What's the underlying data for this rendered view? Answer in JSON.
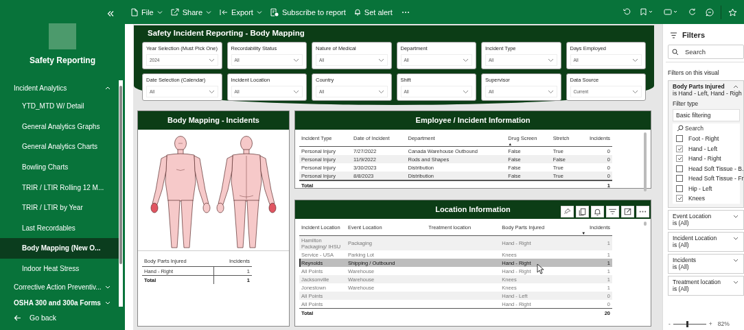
{
  "sidebar": {
    "title": "Safety Reporting",
    "nav": [
      {
        "label": "Incident Analytics",
        "expanded": true,
        "emphasis": false,
        "children": [
          {
            "label": "YTD_MTD W/ Detail",
            "selected": false
          },
          {
            "label": "General Analytics Graphs",
            "selected": false
          },
          {
            "label": "General Analytics Charts",
            "selected": false
          },
          {
            "label": "Bowling Charts",
            "selected": false
          },
          {
            "label": "TRIR / LTIR Rolling 12 M...",
            "selected": false
          },
          {
            "label": "TRIR / LTIR by Year",
            "selected": false
          },
          {
            "label": "Last Recordables",
            "selected": false
          },
          {
            "label": "Body Mapping (New O...",
            "selected": true
          },
          {
            "label": "Indoor Heat Stress",
            "selected": false
          }
        ]
      },
      {
        "label": "Corrective Action Preventiv...",
        "expanded": false,
        "emphasis": false
      },
      {
        "label": "OSHA 300 and 300a Forms",
        "expanded": false,
        "emphasis": true
      }
    ],
    "back": "Go back"
  },
  "toolbar": {
    "menus": [
      {
        "kind": "file",
        "label": "File",
        "dropdown": true
      },
      {
        "kind": "share",
        "label": "Share",
        "dropdown": true
      },
      {
        "kind": "export",
        "label": "Export",
        "dropdown": true
      },
      {
        "kind": "subscribe",
        "label": "Subscribe to report",
        "dropdown": false
      },
      {
        "kind": "alert",
        "label": "Set alert",
        "dropdown": false
      }
    ]
  },
  "report": {
    "title": "Safety Incident Reporting - Body Mapping",
    "slicers": [
      {
        "label": "Year Selection (Must Pick One)",
        "value": "2024"
      },
      {
        "label": "Recordability Status",
        "value": "All"
      },
      {
        "label": "Nature of Medical",
        "value": "All"
      },
      {
        "label": "Department",
        "value": "All"
      },
      {
        "label": "Incident Type",
        "value": "All"
      },
      {
        "label": "Days Employed",
        "value": "All"
      },
      {
        "label": "Date Selection (Calendar)",
        "value": "All"
      },
      {
        "label": "Incident Location",
        "value": "All"
      },
      {
        "label": "Country",
        "value": "All"
      },
      {
        "label": "Shift",
        "value": "All"
      },
      {
        "label": "Supervisor",
        "value": "All"
      },
      {
        "label": "Data Source",
        "value": "Current"
      }
    ]
  },
  "body_panel": {
    "title": "Body Mapping - Incidents",
    "figures": [
      {
        "kind": "front",
        "hand_marked": true
      },
      {
        "kind": "back",
        "hand_marked": true
      }
    ],
    "columns": [
      "Body Parts Injured",
      "Incidents"
    ],
    "rows": [
      [
        "Hand - Right",
        "1"
      ]
    ],
    "total": [
      "Total",
      "1"
    ]
  },
  "employee_panel": {
    "title": "Employee / Incident Information",
    "columns": [
      {
        "label": "Incident Type"
      },
      {
        "label": "Date of Incident"
      },
      {
        "label": "Department"
      },
      {
        "label": "Drug Screen",
        "sort_arrow": "▲"
      },
      {
        "label": "Stretch"
      },
      {
        "label": "Incidents"
      }
    ],
    "rows": [
      [
        "Personal Injury",
        "7/27/2022",
        "Canada Warehouse Outbound",
        "False",
        "True",
        "0"
      ],
      [
        "Personal Injury",
        "11/9/2022",
        "Rods and Shapes",
        "False",
        "False",
        "0"
      ],
      [
        "Personal Injury",
        "3/30/2023",
        "Distribution",
        "False",
        "True",
        "0"
      ],
      [
        "Personal Injury",
        "8/8/2023",
        "Distribution",
        "False",
        "True",
        "0"
      ]
    ],
    "total": {
      "label": "Total",
      "value": "1"
    }
  },
  "location_panel": {
    "title": "Location Information",
    "columns": [
      {
        "label": "Incident Location"
      },
      {
        "label": "Event Location"
      },
      {
        "label": "Treatment location"
      },
      {
        "label": "Body Parts Injured"
      },
      {
        "label": "Incidents",
        "sort_arrow": "▼"
      }
    ],
    "rows": [
      {
        "cells": [
          "Hamilton Packaging/ IHSU",
          "Packaging",
          "",
          "Hand - Right",
          "1"
        ],
        "selected": false
      },
      {
        "cells": [
          "Service - USA",
          "Parking Lot",
          "",
          "Knees",
          "1"
        ],
        "selected": false
      },
      {
        "cells": [
          "Reynolds",
          "Shipping / Outbound",
          "",
          "Hand - Right",
          "1"
        ],
        "selected": true
      },
      {
        "cells": [
          "All Points",
          "Warehouse",
          "",
          "Hand - Right",
          "1"
        ],
        "selected": false
      },
      {
        "cells": [
          "Jacksonville",
          "Warehouse",
          "",
          "Knees",
          "1"
        ],
        "selected": false
      },
      {
        "cells": [
          "Jonestown",
          "Warehouse",
          "",
          "Knees",
          "1"
        ],
        "selected": false
      },
      {
        "cells": [
          "All Points",
          "",
          "",
          "Hand - Left",
          "0"
        ],
        "selected": false
      },
      {
        "cells": [
          "All Points",
          "",
          "",
          "Hand - Right",
          "0"
        ],
        "selected": false
      }
    ],
    "total": {
      "label": "Total",
      "value": "20"
    }
  },
  "filters": {
    "title": "Filters",
    "search_placeholder": "Search",
    "section": "Filters on this visual",
    "cards": [
      {
        "title": "Body Parts Injured",
        "summary": "is Hand - Left, Hand - Righ",
        "expanded": true,
        "filter_type_label": "Filter type",
        "filter_type": "Basic filtering",
        "search_placeholder": "Search",
        "options": [
          {
            "label": "Foot - Right",
            "checked": false
          },
          {
            "label": "Hand - Left",
            "checked": true
          },
          {
            "label": "Hand - Right",
            "checked": true
          },
          {
            "label": "Head Soft Tissue - B.",
            "checked": false
          },
          {
            "label": "Head Soft Tissue - Fr",
            "checked": false
          },
          {
            "label": "Hip - Left",
            "checked": false
          },
          {
            "label": "Knees",
            "checked": true
          }
        ]
      },
      {
        "title": "Event Location",
        "summary": "is (All)",
        "expanded": false
      },
      {
        "title": "Incident Location",
        "summary": "is (All)",
        "expanded": false
      },
      {
        "title": "Incidents",
        "summary": "is (All)",
        "expanded": false
      },
      {
        "title": "Treatment location",
        "summary": "is (All)",
        "expanded": false
      }
    ]
  },
  "zoom": {
    "out": "-",
    "in": "+",
    "level": 0.4,
    "value": "82%"
  }
}
